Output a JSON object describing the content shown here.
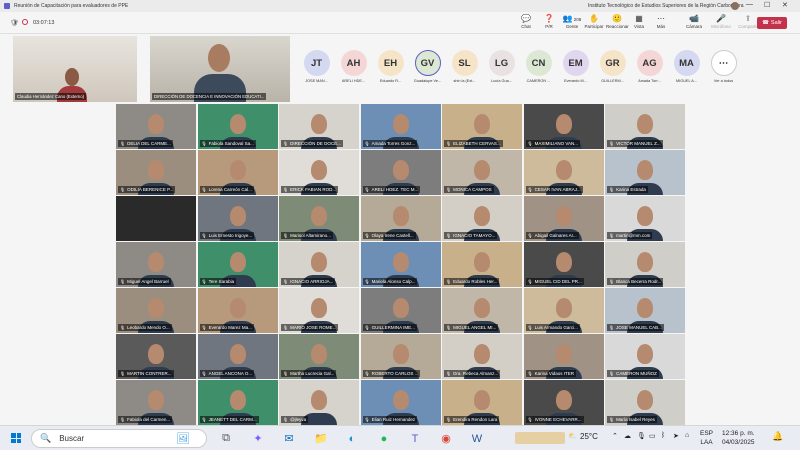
{
  "window": {
    "title": "Reunión de Capacitación para evaluadores de PPE",
    "organization": "Instituto Tecnológico de Estudios Superiores de la Región Carbonífera"
  },
  "toolbar": {
    "timer": "03:07:13",
    "buttons": [
      {
        "name": "chat",
        "label": "Chat",
        "icon": "chat-icon",
        "glyph": "💬"
      },
      {
        "name": "qa",
        "label": "P/R",
        "icon": "question-icon",
        "glyph": "❓"
      },
      {
        "name": "people",
        "label": "Gente",
        "icon": "people-icon",
        "glyph": "👥",
        "badge": "208"
      },
      {
        "name": "raise",
        "label": "Participar",
        "icon": "hand-icon",
        "glyph": "✋"
      },
      {
        "name": "react",
        "label": "Reaccionar",
        "icon": "smile-icon",
        "glyph": "🙂"
      },
      {
        "name": "view",
        "label": "Vista",
        "icon": "grid-icon",
        "glyph": "▦"
      },
      {
        "name": "more",
        "label": "Más",
        "icon": "more-icon",
        "glyph": "⋯"
      },
      {
        "name": "camera",
        "label": "Cámara",
        "icon": "camera-icon",
        "glyph": "📹"
      },
      {
        "name": "mic",
        "label": "Micrófono",
        "icon": "mic-icon",
        "glyph": "🎤"
      },
      {
        "name": "share",
        "label": "Compartir",
        "icon": "share-icon",
        "glyph": "⬆"
      }
    ],
    "leave_label": "Salir"
  },
  "pinned": [
    {
      "name": "Claudia Hernández Cano (Externo)"
    },
    {
      "name": "DIRECCIÓN DE DOCENCIA E INNOVACIÓN EDUCATI..."
    }
  ],
  "avatars": [
    {
      "initials": "JT",
      "label": "JOSE MAN...",
      "color": "#d4d8f0"
    },
    {
      "initials": "AH",
      "label": "ARELI HDE...",
      "color": "#f5d6d6"
    },
    {
      "initials": "EH",
      "label": "Eduardo R...",
      "color": "#f6e4c8"
    },
    {
      "initials": "GV",
      "label": "Guadalupe Ve...",
      "color": "#dce8d4"
    },
    {
      "initials": "SL",
      "label": "shin la (Ext...",
      "color": "#f6e4c8"
    },
    {
      "initials": "LG",
      "label": "Lucía Gua...",
      "color": "#e8e2e2"
    },
    {
      "initials": "CN",
      "label": "CAMERON ...",
      "color": "#dce8d4"
    },
    {
      "initials": "EM",
      "label": "Everardo M...",
      "color": "#e0d6ef"
    },
    {
      "initials": "GR",
      "label": "GUILLERM...",
      "color": "#f6e4c8"
    },
    {
      "initials": "AG",
      "label": "Amada Torr...",
      "color": "#f5d6d6"
    },
    {
      "initials": "MA",
      "label": "MIGUEL A...",
      "color": "#d4d8f0"
    },
    {
      "initials": "⋯",
      "label": "Ver a todos",
      "color": "#ffffff"
    }
  ],
  "tiles": [
    "DELIA  DEL CARME...",
    "Fabiola Sandoval Sa...",
    "DIRECCIÓN DE DOCE...",
    "Amada Torres Gonz...",
    "ELIZABETH CERVAS...",
    "MAXIMILIANO VAN...",
    "VICTOR MANUEL Z...",
    "ODILIA BERENICE P...",
    "Lorena Carreón Cal...",
    "ERICK FABIAN ROD...",
    "ARELI HDEZ. TEC M...",
    "MONICA CAMPOS",
    "CESAR IVAN ABRAJ...",
    "Karina Estrada",
    "",
    "Luis Ernesto Irigoye...",
    "Marisol Altamirano...",
    "Olaya Irene Castell...",
    "IGNACIO TAMAYO...",
    "Abigail Galnares Ar...",
    "martin@mm.com",
    "Miguel Angel Barruel",
    "Tere Sarabia",
    "IGNACIO ARRIOJA...",
    "Mariela Alonso Calp...",
    "Eduardo Robles Her...",
    "MIGUEL CID DEL PR...",
    "Blanca Becerra Rodr...",
    "Leobardo Mendo O...",
    "Everardo Marez Ma...",
    "MARIO JOSE ROME...",
    "GUILLERMINA IME...",
    "MIGUEL ANGEL MI...",
    "Luis Armando Garci...",
    "JOSE MANUEL CAB...",
    "MARTIN CONTRER...",
    "ANGEL ANCONA O...",
    "Martha Lucrecia Gal...",
    "ROBERTO CARLOS ...",
    "Dra. Rebeca Almanz...",
    "Karina Vidaos ITER",
    "CAMERON MUÑOZ",
    "Fabiola del Carmen...",
    "JEANETT DEL CARM...",
    "@jleyva",
    "Elian Ruiz Hernandez",
    "Erendira Rendon Lara",
    "IVONNE ECHEVARR...",
    "María Isabel Reyes"
  ],
  "taskbar": {
    "search_placeholder": "Buscar",
    "apps": [
      {
        "name": "widgets",
        "icon": "widgets-icon",
        "glyph": "🖼"
      },
      {
        "name": "task-view",
        "icon": "task-view-icon",
        "glyph": "⧉"
      },
      {
        "name": "copilot",
        "icon": "copilot-icon",
        "glyph": "✦"
      },
      {
        "name": "outlook",
        "icon": "outlook-icon",
        "glyph": "✉"
      },
      {
        "name": "explorer",
        "icon": "folder-icon",
        "glyph": "📁"
      },
      {
        "name": "edge",
        "icon": "edge-icon",
        "glyph": "◐"
      },
      {
        "name": "spotify",
        "icon": "spotify-icon",
        "glyph": "●"
      },
      {
        "name": "teams",
        "icon": "teams-icon",
        "glyph": "T"
      },
      {
        "name": "chrome",
        "icon": "chrome-icon",
        "glyph": "◉"
      },
      {
        "name": "word",
        "icon": "word-icon",
        "glyph": "W"
      }
    ],
    "weather": "25°C",
    "language": "ESP",
    "language_sub": "LAA",
    "time": "12:36 p. m.",
    "date": "04/03/2025"
  },
  "colors": {
    "accent": "#5b5fc7",
    "leave": "#c4314b"
  }
}
